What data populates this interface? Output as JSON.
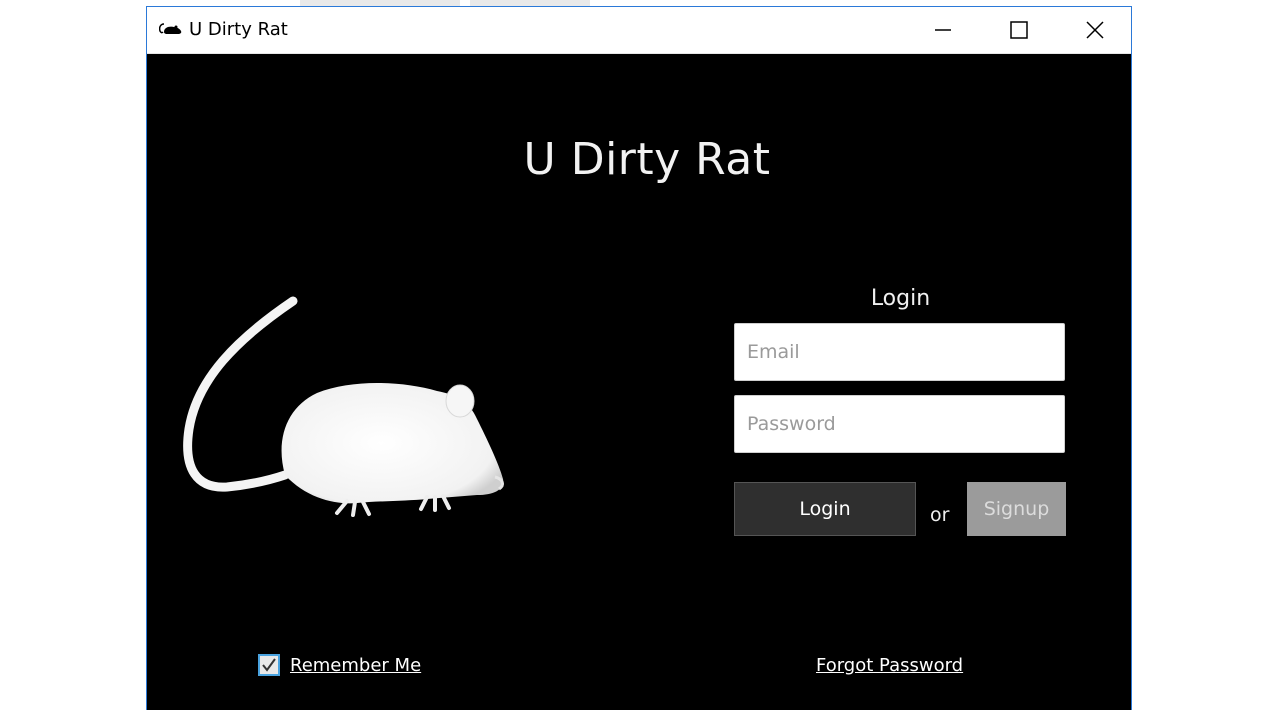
{
  "window": {
    "title": "U Dirty Rat",
    "controls": {
      "minimize": "minimize",
      "maximize": "maximize",
      "close": "close"
    }
  },
  "app": {
    "heading": "U Dirty Rat"
  },
  "login_form": {
    "heading": "Login",
    "email": {
      "value": "",
      "placeholder": "Email"
    },
    "password": {
      "value": "",
      "placeholder": "Password"
    },
    "login_label": "Login",
    "or_label": "or",
    "signup_label": "Signup"
  },
  "footer": {
    "remember_me": {
      "label": "Remember Me",
      "checked": true
    },
    "forgot_password_label": "Forgot Password"
  },
  "icons": {
    "app_icon": "rat-icon",
    "minimize": "minimize-icon",
    "maximize": "maximize-icon",
    "close": "close-icon",
    "checkbox": "check-icon",
    "illustration": "rat-silhouette"
  },
  "colors": {
    "window_bg": "#000000",
    "window_border": "#2b79d8",
    "login_button_bg": "#2f2f2f",
    "signup_button_bg": "#9b9b9b",
    "checkbox_border": "#4aa3df"
  }
}
